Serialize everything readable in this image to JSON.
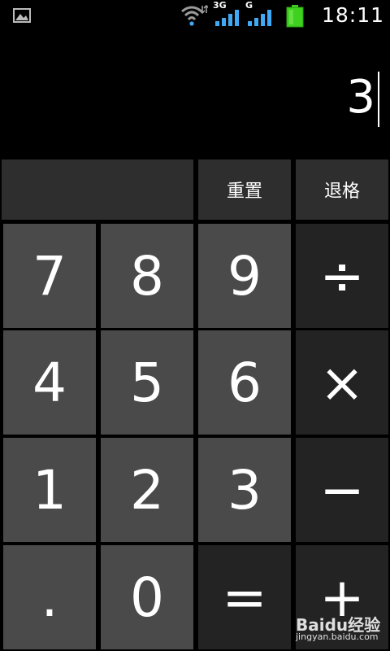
{
  "status_bar": {
    "network_3g": "3G",
    "network_g": "G",
    "time": "18:11",
    "battery_color": "#3ed11e"
  },
  "display": {
    "value": "3"
  },
  "function_row": {
    "reset_label": "重置",
    "backspace_label": "退格"
  },
  "keys": {
    "seven": "7",
    "eight": "8",
    "nine": "9",
    "divide": "÷",
    "four": "4",
    "five": "5",
    "six": "6",
    "multiply": "×",
    "one": "1",
    "two": "2",
    "three": "3",
    "minus": "−",
    "dot": ".",
    "zero": "0",
    "equals": "=",
    "plus": "+"
  },
  "watermark": {
    "brand": "Baidu经验",
    "url": "jingyan.baidu.com"
  },
  "colors": {
    "digit_key": "#4a4a4a",
    "operator_key": "#232323",
    "function_key": "#2e2e2e",
    "background": "#000000"
  }
}
